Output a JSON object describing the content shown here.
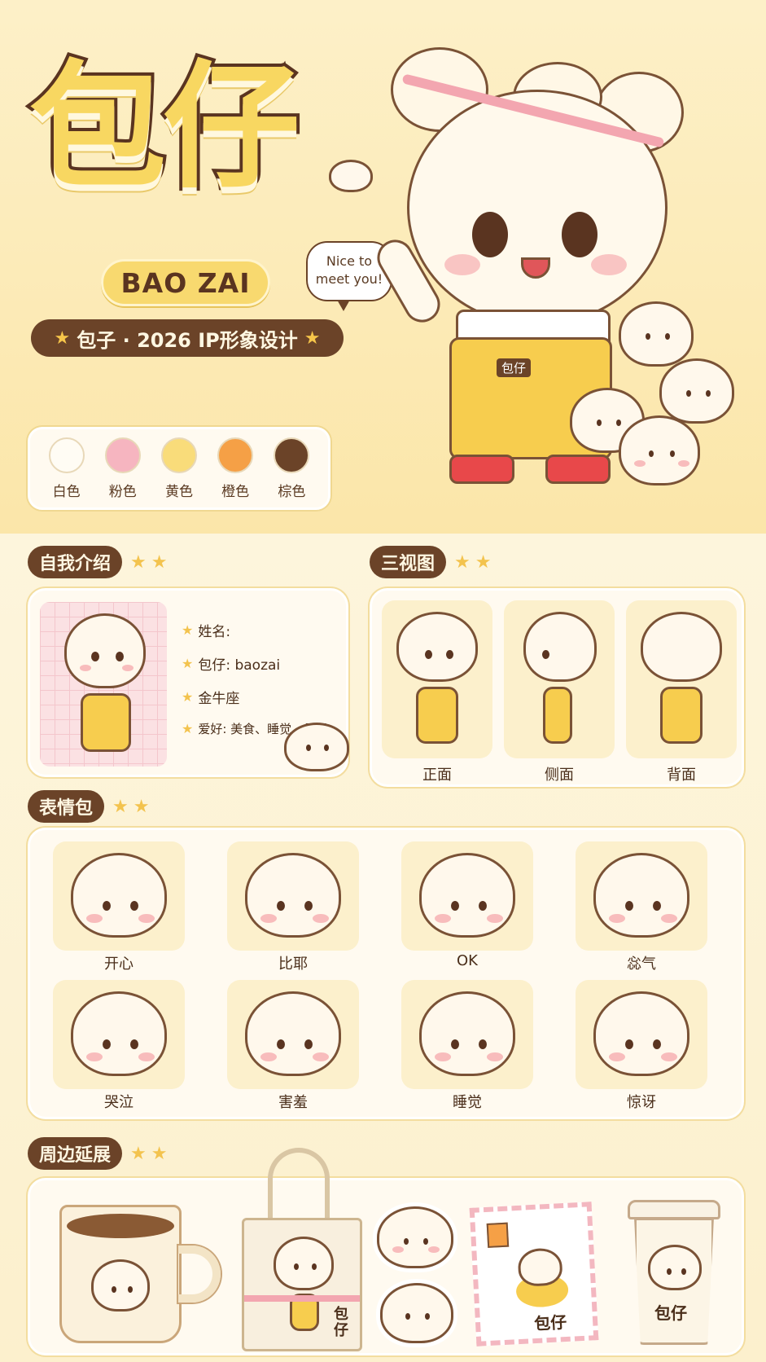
{
  "hero": {
    "title": "包仔",
    "subtitle": "BAO ZAI",
    "tagline": "包子 · 2026  IP形象设计",
    "speech_bubble": "Nice to\nmeet you!",
    "badge": "包仔"
  },
  "palette": [
    {
      "name": "白色",
      "color": "#fffcf4"
    },
    {
      "name": "粉色",
      "color": "#f6b5c0"
    },
    {
      "name": "黄色",
      "color": "#f9dc7a"
    },
    {
      "name": "橙色",
      "color": "#f5a046"
    },
    {
      "name": "棕色",
      "color": "#6b4328"
    }
  ],
  "intro": {
    "label": "自我介绍",
    "items": [
      "姓名:",
      "包仔: baozai",
      "金牛座",
      "爱好: 美食、睡觉、呆呆"
    ]
  },
  "three_view": {
    "label": "三视图",
    "views": [
      "正面",
      "侧面",
      "背面"
    ]
  },
  "emoji": {
    "label": "表情包",
    "items": [
      "开心",
      "比耶",
      "OK",
      "惢气",
      "哭泣",
      "害羞",
      "睡觉",
      "惊讶"
    ]
  },
  "merch": {
    "label": "周边延展",
    "bag_text": "包\n仔",
    "stamp_text": "包仔",
    "cup_text": "包仔"
  },
  "colors": {
    "brown": "#6b4328",
    "yellow": "#f7cd4e",
    "pink": "#f3a6b0",
    "background": "#fdf3d6"
  }
}
